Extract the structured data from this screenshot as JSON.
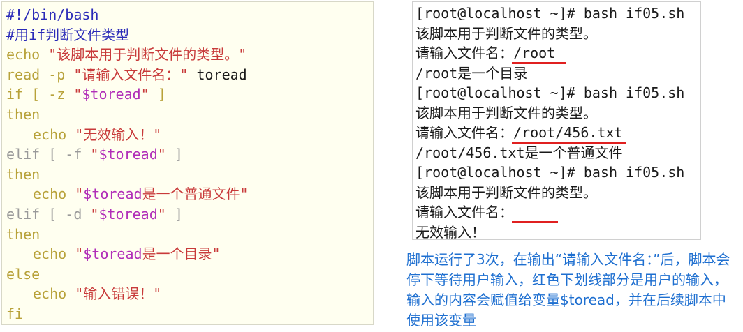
{
  "code": {
    "lines": [
      {
        "parts": [
          {
            "t": "#!/bin/bash",
            "c": "c-comment"
          }
        ]
      },
      {
        "parts": [
          {
            "t": "#用if判断文件类型",
            "c": "c-comment"
          }
        ]
      },
      {
        "parts": [
          {
            "t": "echo ",
            "c": "c-kw"
          },
          {
            "t": "\"该脚本用于判断文件的类型。\"",
            "c": "c-str"
          }
        ]
      },
      {
        "parts": [
          {
            "t": "read -p ",
            "c": "c-kw"
          },
          {
            "t": "\"请输入文件名：\"",
            "c": "c-str"
          },
          {
            "t": " toread",
            "c": "c-plain"
          }
        ]
      },
      {
        "parts": [
          {
            "t": "if [ -z ",
            "c": "c-kw"
          },
          {
            "t": "\"",
            "c": "c-str"
          },
          {
            "t": "$toread",
            "c": "c-var"
          },
          {
            "t": "\"",
            "c": "c-str"
          },
          {
            "t": " ]",
            "c": "c-kw"
          }
        ]
      },
      {
        "parts": [
          {
            "t": "then",
            "c": "c-kw"
          }
        ]
      },
      {
        "indent": true,
        "parts": [
          {
            "t": "echo ",
            "c": "c-kw"
          },
          {
            "t": "\"无效输入！\"",
            "c": "c-str"
          }
        ]
      },
      {
        "parts": [
          {
            "t": "elif [ -f ",
            "c": "c-kwgray"
          },
          {
            "t": "\"",
            "c": "c-str"
          },
          {
            "t": "$toread",
            "c": "c-var"
          },
          {
            "t": "\"",
            "c": "c-str"
          },
          {
            "t": " ]",
            "c": "c-kwgray"
          }
        ]
      },
      {
        "parts": [
          {
            "t": "then",
            "c": "c-kw"
          }
        ]
      },
      {
        "indent": true,
        "parts": [
          {
            "t": "echo ",
            "c": "c-kw"
          },
          {
            "t": "\"",
            "c": "c-str"
          },
          {
            "t": "$toread",
            "c": "c-var"
          },
          {
            "t": "是一个普通文件\"",
            "c": "c-str"
          }
        ]
      },
      {
        "parts": [
          {
            "t": "elif [ -d ",
            "c": "c-kwgray"
          },
          {
            "t": "\"",
            "c": "c-str"
          },
          {
            "t": "$toread",
            "c": "c-var"
          },
          {
            "t": "\"",
            "c": "c-str"
          },
          {
            "t": " ]",
            "c": "c-kwgray"
          }
        ]
      },
      {
        "parts": [
          {
            "t": "then",
            "c": "c-kw"
          }
        ]
      },
      {
        "indent": true,
        "parts": [
          {
            "t": "echo ",
            "c": "c-kw"
          },
          {
            "t": "\"",
            "c": "c-str"
          },
          {
            "t": "$toread",
            "c": "c-var"
          },
          {
            "t": "是一个目录\"",
            "c": "c-str"
          }
        ]
      },
      {
        "parts": [
          {
            "t": "else",
            "c": "c-kw"
          }
        ]
      },
      {
        "indent": true,
        "parts": [
          {
            "t": "echo ",
            "c": "c-kw"
          },
          {
            "t": "\"输入错误！\"",
            "c": "c-str"
          }
        ]
      },
      {
        "parts": [
          {
            "t": "fi",
            "c": "c-kw"
          }
        ]
      }
    ]
  },
  "terminal": {
    "lines": [
      {
        "text": "[root@localhost ~]# bash if05.sh"
      },
      {
        "text": "该脚本用于判断文件的类型。"
      },
      {
        "text": "请输入文件名：",
        "input": "/root "
      },
      {
        "text": "/root是一个目录"
      },
      {
        "text": "[root@localhost ~]# bash if05.sh"
      },
      {
        "text": "该脚本用于判断文件的类型。"
      },
      {
        "text": "请输入文件名：",
        "input": "/root/456.txt"
      },
      {
        "text": "/root/456.txt是一个普通文件"
      },
      {
        "text": "[root@localhost ~]# bash if05.sh"
      },
      {
        "text": "该脚本用于判断文件的类型。"
      },
      {
        "text": "请输入文件名：",
        "input": "     "
      },
      {
        "text": "无效输入！"
      }
    ]
  },
  "annotation": {
    "text": "脚本运行了3次，在输出“请输入文件名：”后，脚本会停下等待用户输入，红色下划线部分是用户的输入，输入的内容会赋值给变量$toread，并在后续脚本中使用该变量"
  },
  "colors": {
    "underline": "#e02020",
    "annotation": "#1e6fd0"
  }
}
